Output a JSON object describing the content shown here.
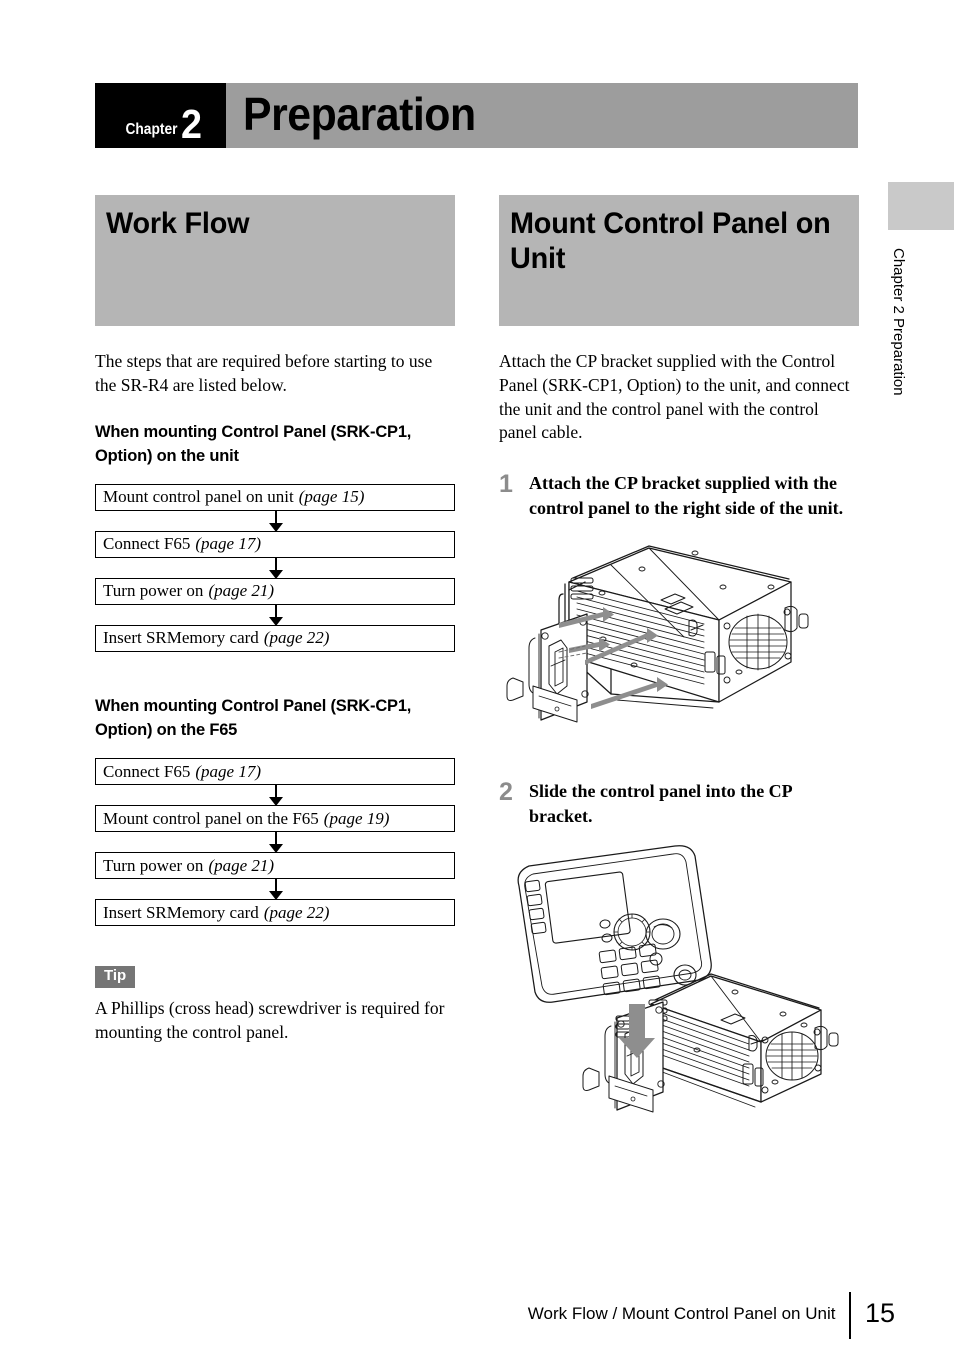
{
  "chapter": {
    "label": "Chapter",
    "number": "2",
    "title": "Preparation"
  },
  "side_running_head": "Chapter 2  Preparation",
  "left_column": {
    "heading": "Work Flow",
    "intro": "The steps that are required before starting to use the SR-R4 are listed below.",
    "subhead_1": "When mounting Control Panel (SRK-CP1, Option) on the unit",
    "flow_1": [
      {
        "text": "Mount control panel on unit",
        "page": "(page 15)"
      },
      {
        "text": "Connect F65",
        "page": "(page 17)"
      },
      {
        "text": "Turn power on",
        "page": "(page 21)"
      },
      {
        "text": "Insert SRMemory card",
        "page": "(page 22)"
      }
    ],
    "subhead_2": "When mounting Control Panel (SRK-CP1, Option) on the F65",
    "flow_2": [
      {
        "text": "Connect F65",
        "page": "(page 17)"
      },
      {
        "text": "Mount control panel on the F65",
        "page": "(page 19)"
      },
      {
        "text": "Turn power on",
        "page": "(page 21)"
      },
      {
        "text": "Insert SRMemory card",
        "page": "(page 22)"
      }
    ],
    "tip_label": "Tip",
    "tip_text": "A Phillips (cross head) screwdriver is required for mounting the control panel."
  },
  "right_column": {
    "heading": "Mount Control Panel on Unit",
    "intro": "Attach the CP bracket supplied with the Control Panel (SRK-CP1, Option) to the unit, and connect the unit and the control panel with the control panel cable.",
    "steps": [
      {
        "number": "1",
        "text": "Attach the CP bracket supplied with the control panel to the right side of the unit.",
        "figure_name": "recorder-unit-with-cp-bracket-exploded-diagram"
      },
      {
        "number": "2",
        "text": "Slide the control panel into the CP bracket.",
        "figure_name": "control-panel-sliding-into-cp-bracket-diagram"
      }
    ]
  },
  "footer": {
    "title": "Work Flow / Mount Control Panel on Unit",
    "page_number": "15"
  },
  "colors": {
    "banner_gray": "#b5b5b5",
    "chapter_banner_gray": "#9d9d9d",
    "tab_gray": "#c9c9c9",
    "tip_gray": "#757575",
    "step_number_gray": "#8c8c8c",
    "arrow_gray": "#8e8e8e",
    "line_black": "#000000"
  }
}
